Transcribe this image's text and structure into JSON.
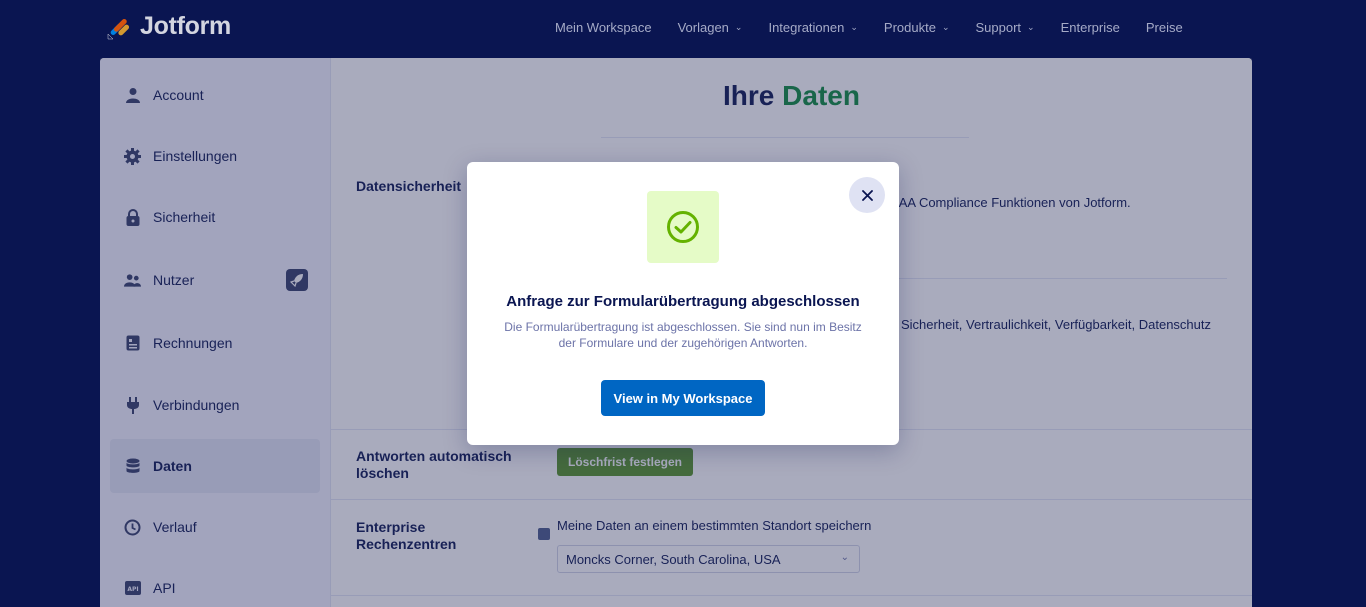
{
  "brand": {
    "name": "Jotform"
  },
  "nav": {
    "items": [
      {
        "label": "Mein Workspace",
        "dropdown": false
      },
      {
        "label": "Vorlagen",
        "dropdown": true
      },
      {
        "label": "Integrationen",
        "dropdown": true
      },
      {
        "label": "Produkte",
        "dropdown": true
      },
      {
        "label": "Support",
        "dropdown": true
      },
      {
        "label": "Enterprise",
        "dropdown": false
      },
      {
        "label": "Preise",
        "dropdown": false
      }
    ]
  },
  "sidebar": {
    "items": [
      {
        "label": "Account",
        "icon": "user-icon"
      },
      {
        "label": "Einstellungen",
        "icon": "gear-icon"
      },
      {
        "label": "Sicherheit",
        "icon": "lock-icon"
      },
      {
        "label": "Nutzer",
        "icon": "users-icon",
        "badge_icon": "rocket-icon"
      },
      {
        "label": "Rechnungen",
        "icon": "invoice-icon"
      },
      {
        "label": "Verbindungen",
        "icon": "plug-icon"
      },
      {
        "label": "Daten",
        "icon": "database-icon",
        "active": true
      },
      {
        "label": "Verlauf",
        "icon": "history-icon"
      },
      {
        "label": "API",
        "icon": "api-icon"
      }
    ]
  },
  "page": {
    "title_part1": "Ihre",
    "title_part2": "Daten",
    "sections": {
      "security_label": "Datensicherheit",
      "security_text_1": "PAA Compliance Funktionen von Jotform.",
      "security_text_2": "Sicherheit, Vertraulichkeit, Verfügbarkeit, Datenschutz",
      "autodelete_label_line1": "Antworten automatisch",
      "autodelete_label_line2": "löschen",
      "autodelete_button": "Löschfrist festlegen",
      "datacenter_label_line1": "Enterprise",
      "datacenter_label_line2": "Rechenzentren",
      "datacenter_checkbox_label": "Meine Daten an einem bestimmten Standort speichern",
      "datacenter_select_value": "Moncks Corner, South Carolina, USA"
    }
  },
  "modal": {
    "title": "Anfrage zur Formularübertragung abgeschlossen",
    "description": "Die Formularübertragung ist abgeschlossen. Sie sind nun im Besitz der Formulare und der zugehörigen Antworten.",
    "primary_button": "View in My Workspace",
    "close_icon": "close-icon",
    "status_icon": "check-circle-icon"
  },
  "colors": {
    "background": "#0a1551",
    "accent_green": "#0d8a3e",
    "primary_blue": "#0066c3",
    "success_box": "#e5fbc7",
    "success_icon": "#64b200"
  }
}
